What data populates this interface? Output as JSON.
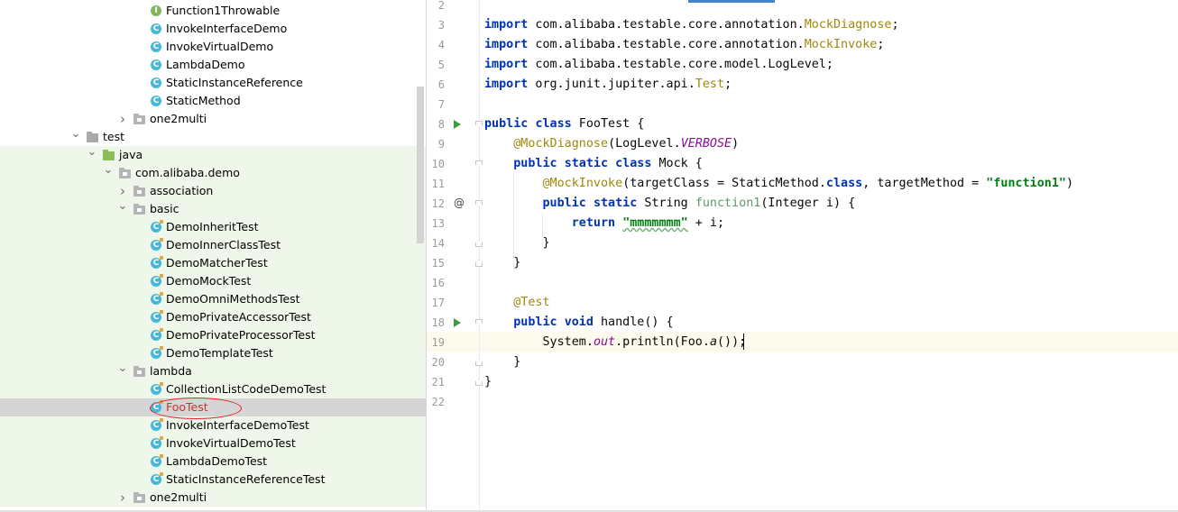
{
  "tree": {
    "items": [
      {
        "label": "Function1Throwable",
        "type": "interface",
        "depth": 3
      },
      {
        "label": "InvokeInterfaceDemo",
        "type": "class",
        "depth": 3
      },
      {
        "label": "InvokeVirtualDemo",
        "type": "class",
        "depth": 3
      },
      {
        "label": "LambdaDemo",
        "type": "class",
        "depth": 3
      },
      {
        "label": "StaticInstanceReference",
        "type": "class",
        "depth": 3
      },
      {
        "label": "StaticMethod",
        "type": "class",
        "depth": 3
      },
      {
        "label": "one2multi",
        "type": "package",
        "depth": 2,
        "expanded": false
      },
      {
        "label": "test",
        "type": "folder",
        "depth": 0,
        "expanded": true
      },
      {
        "label": "java",
        "type": "source-folder",
        "depth": 1,
        "expanded": true
      },
      {
        "label": "com.alibaba.demo",
        "type": "package",
        "depth": 1.5,
        "expanded": true
      },
      {
        "label": "association",
        "type": "package",
        "depth": 2,
        "expanded": false
      },
      {
        "label": "basic",
        "type": "package",
        "depth": 2,
        "expanded": true
      },
      {
        "label": "DemoInheritTest",
        "type": "test-class",
        "depth": 3
      },
      {
        "label": "DemoInnerClassTest",
        "type": "test-class",
        "depth": 3
      },
      {
        "label": "DemoMatcherTest",
        "type": "test-class",
        "depth": 3
      },
      {
        "label": "DemoMockTest",
        "type": "test-class",
        "depth": 3
      },
      {
        "label": "DemoOmniMethodsTest",
        "type": "test-class",
        "depth": 3
      },
      {
        "label": "DemoPrivateAccessorTest",
        "type": "test-class",
        "depth": 3
      },
      {
        "label": "DemoPrivateProcessorTest",
        "type": "test-class",
        "depth": 3
      },
      {
        "label": "DemoTemplateTest",
        "type": "test-class",
        "depth": 3
      },
      {
        "label": "lambda",
        "type": "package",
        "depth": 2,
        "expanded": true
      },
      {
        "label": "CollectionListCodeDemoTest",
        "type": "test-class",
        "depth": 3
      },
      {
        "label": "FooTest",
        "type": "test-class",
        "depth": 3,
        "selected": true
      },
      {
        "label": "InvokeInterfaceDemoTest",
        "type": "test-class",
        "depth": 3
      },
      {
        "label": "InvokeVirtualDemoTest",
        "type": "test-class",
        "depth": 3
      },
      {
        "label": "LambdaDemoTest",
        "type": "test-class",
        "depth": 3
      },
      {
        "label": "StaticInstanceReferenceTest",
        "type": "test-class",
        "depth": 3
      },
      {
        "label": "one2multi",
        "type": "package",
        "depth": 2,
        "expanded": false
      }
    ],
    "class_icon_letter": "C",
    "interface_icon_letter": "I"
  },
  "editor": {
    "line_numbers": [
      "2",
      "3",
      "4",
      "5",
      "6",
      "7",
      "8",
      "9",
      "10",
      "11",
      "12",
      "13",
      "14",
      "15",
      "16",
      "17",
      "18",
      "19",
      "20",
      "21",
      "22"
    ],
    "current_line": "19",
    "lines": [
      [],
      [
        {
          "t": "import",
          "c": "kw"
        },
        {
          "t": " com.alibaba.testable.core.annotation."
        },
        {
          "t": "MockDiagnose",
          "c": "ann"
        },
        {
          "t": ";"
        }
      ],
      [
        {
          "t": "import",
          "c": "kw"
        },
        {
          "t": " com.alibaba.testable.core.annotation."
        },
        {
          "t": "MockInvoke",
          "c": "ann"
        },
        {
          "t": ";"
        }
      ],
      [
        {
          "t": "import",
          "c": "kw"
        },
        {
          "t": " com.alibaba.testable.core.model.LogLevel;"
        }
      ],
      [
        {
          "t": "import",
          "c": "kw"
        },
        {
          "t": " org.junit.jupiter.api."
        },
        {
          "t": "Test",
          "c": "ann"
        },
        {
          "t": ";"
        }
      ],
      [],
      [
        {
          "t": "public",
          "c": "kw"
        },
        {
          "t": " "
        },
        {
          "t": "class",
          "c": "kw"
        },
        {
          "t": " FooTest {"
        }
      ],
      [
        {
          "t": "    "
        },
        {
          "t": "@MockDiagnose",
          "c": "ann"
        },
        {
          "t": "(LogLevel."
        },
        {
          "t": "VERBOSE",
          "c": "fld"
        },
        {
          "t": ")"
        }
      ],
      [
        {
          "t": "    "
        },
        {
          "t": "public",
          "c": "kw"
        },
        {
          "t": " "
        },
        {
          "t": "static",
          "c": "kw"
        },
        {
          "t": " "
        },
        {
          "t": "class",
          "c": "kw"
        },
        {
          "t": " Mock {"
        }
      ],
      [
        {
          "t": "        "
        },
        {
          "t": "@MockInvoke",
          "c": "ann"
        },
        {
          "t": "(targetClass = StaticMethod."
        },
        {
          "t": "class",
          "c": "kw"
        },
        {
          "t": ", targetMethod = "
        },
        {
          "t": "\"function1\"",
          "c": "str"
        },
        {
          "t": ")"
        }
      ],
      [
        {
          "t": "        "
        },
        {
          "t": "public",
          "c": "kw"
        },
        {
          "t": " "
        },
        {
          "t": "static",
          "c": "kw"
        },
        {
          "t": " String "
        },
        {
          "t": "function1",
          "c": "unused"
        },
        {
          "t": "(Integer i) {"
        }
      ],
      [
        {
          "t": "            "
        },
        {
          "t": "return",
          "c": "kw"
        },
        {
          "t": " "
        },
        {
          "t": "\"mmmmmmm\"",
          "c": "str typo"
        },
        {
          "t": " + i;"
        }
      ],
      [
        {
          "t": "        }"
        }
      ],
      [
        {
          "t": "    }"
        }
      ],
      [],
      [
        {
          "t": "    "
        },
        {
          "t": "@Test",
          "c": "ann"
        }
      ],
      [
        {
          "t": "    "
        },
        {
          "t": "public",
          "c": "kw"
        },
        {
          "t": " "
        },
        {
          "t": "void",
          "c": "kw"
        },
        {
          "t": " handle() {"
        }
      ],
      [
        {
          "t": "        System."
        },
        {
          "t": "out",
          "c": "fld"
        },
        {
          "t": ".println(Foo."
        },
        {
          "t": "a",
          "c": "ital"
        },
        {
          "t": "());"
        }
      ],
      [
        {
          "t": "    }"
        }
      ],
      [
        {
          "t": "}"
        }
      ],
      []
    ]
  },
  "colors": {
    "test_zone": "#eff7ea",
    "selected_row": "#d5d5d5",
    "keyword": "#0033b3",
    "annotation": "#9e880d",
    "string": "#067d17",
    "highlight_ellipse": "#e02020"
  }
}
